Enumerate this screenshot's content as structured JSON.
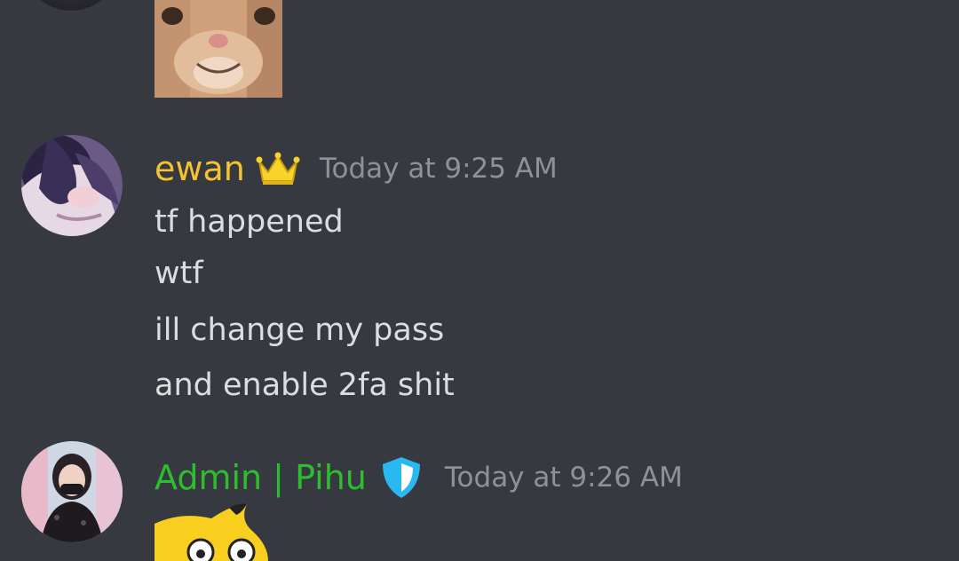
{
  "colors": {
    "background": "#36393f",
    "message_text": "#dcddde",
    "timestamp": "#8e9297",
    "owner_name": "#f4c430",
    "admin_name": "#2ebd2e",
    "crown": "#f8d32a",
    "shield": "#29b9f0"
  },
  "top_message": {
    "image": "cat-face-image"
  },
  "messages": [
    {
      "username": "ewan",
      "badge_icon": "crown-icon",
      "timestamp": "Today at 9:25 AM",
      "lines": [
        "tf happened",
        "wtf",
        "ill change my pass",
        "and enable 2fa shit"
      ]
    },
    {
      "username": "Admin | Pihu",
      "badge_icon": "shield-icon",
      "timestamp": "Today at 9:26 AM",
      "sticker": "pikachu-sticker"
    }
  ]
}
